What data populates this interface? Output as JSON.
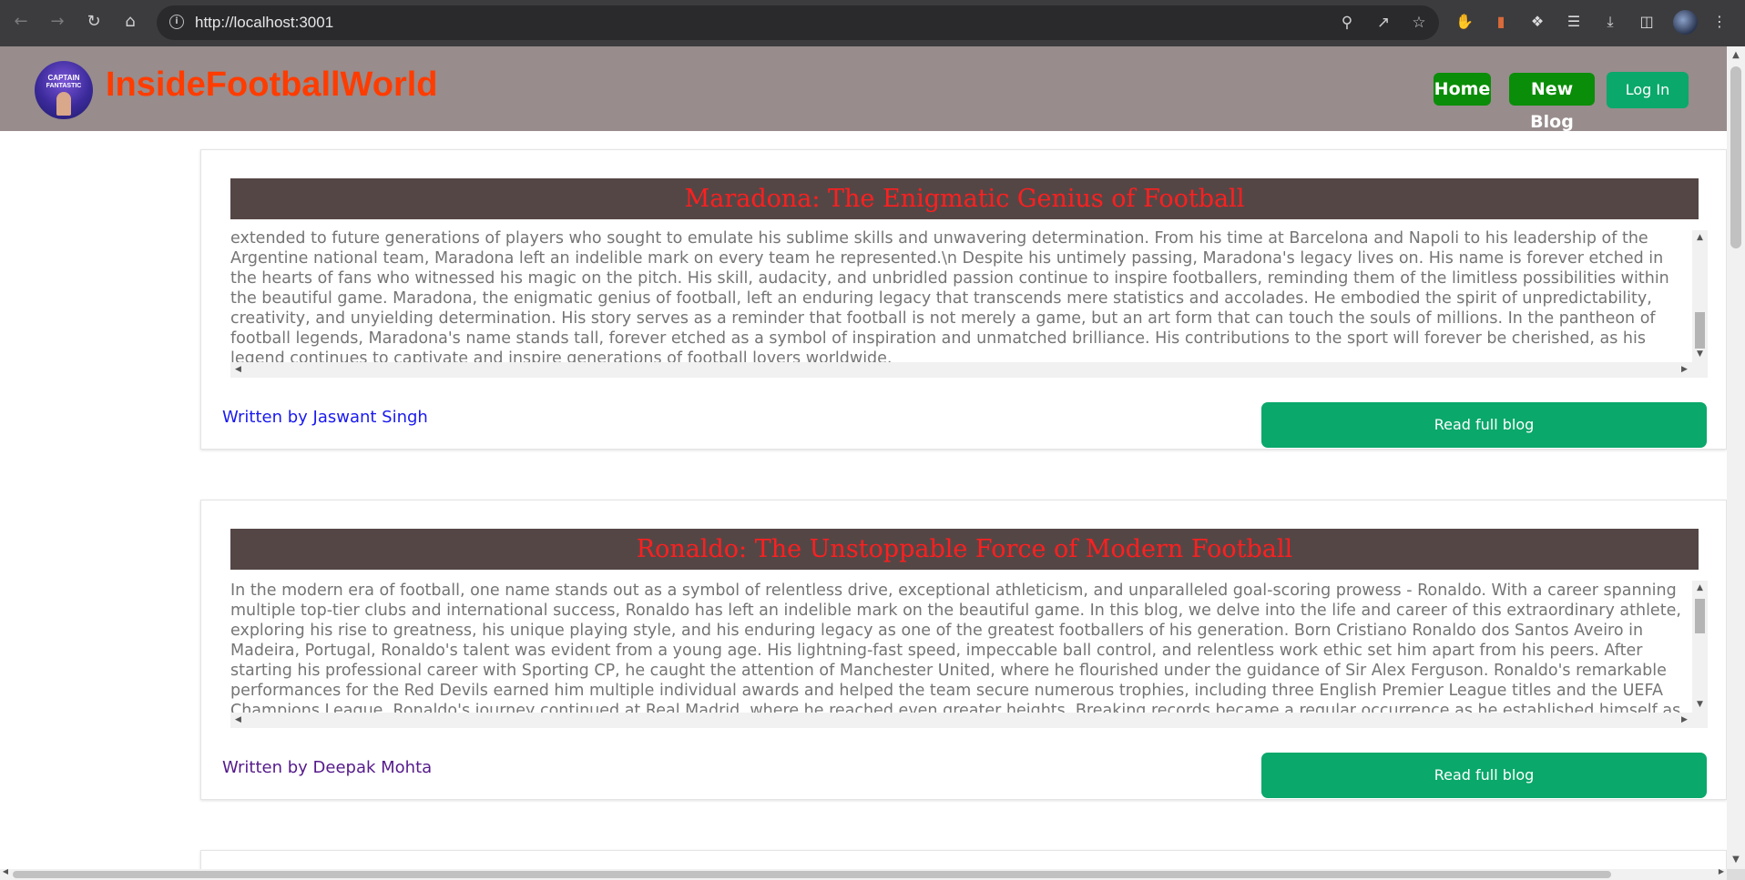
{
  "browser": {
    "url": "http://localhost:3001",
    "icons": [
      "back-icon",
      "forward-icon",
      "reload-icon",
      "home-icon",
      "site-info-icon",
      "zoom-icon",
      "share-icon",
      "bookmark-star-icon",
      "extension-stop-icon",
      "extension-book-icon",
      "extensions-puzzle-icon",
      "media-queue-icon",
      "download-icon",
      "side-panel-icon",
      "profile-avatar",
      "menu-kebab-icon"
    ]
  },
  "site": {
    "title": "InsideFootballWorld",
    "title_color": "#ff3c00",
    "header_bg": "#988c8c",
    "logo_text": [
      "CAPTAIN",
      "FANTASTIC"
    ],
    "nav": {
      "home": "Home",
      "new_blog": "New Blog",
      "login": "Log In"
    }
  },
  "posts": [
    {
      "title": "Maradona: The Enigmatic Genius of Football",
      "excerpt": "extended to future generations of players who sought to emulate his sublime skills and unwavering determination. From his time at Barcelona and Napoli to his leadership of the Argentine national team, Maradona left an indelible mark on every team he represented.\\n Despite his untimely passing, Maradona's legacy lives on. His name is forever etched in the hearts of fans who witnessed his magic on the pitch. His skill, audacity, and unbridled passion continue to inspire footballers, reminding them of the limitless possibilities within the beautiful game. Maradona, the enigmatic genius of football, left an enduring legacy that transcends mere statistics and accolades. He embodied the spirit of unpredictability, creativity, and unyielding determination. His story serves as a reminder that football is not merely a game, but an art form that can touch the souls of millions. In the pantheon of football legends, Maradona's name stands tall, forever etched as a symbol of inspiration and unmatched brilliance. His contributions to the sport will forever be cherished, as his legend continues to captivate and inspire generations of football lovers worldwide.",
      "author": "Written by Jaswant Singh",
      "read_label": "Read full blog"
    },
    {
      "title": "Ronaldo: The Unstoppable Force of Modern Football",
      "excerpt": "In the modern era of football, one name stands out as a symbol of relentless drive, exceptional athleticism, and unparalleled goal-scoring prowess - Ronaldo. With a career spanning multiple top-tier clubs and international success, Ronaldo has left an indelible mark on the beautiful game. In this blog, we delve into the life and career of this extraordinary athlete, exploring his rise to greatness, his unique playing style, and his enduring legacy as one of the greatest footballers of his generation. Born Cristiano Ronaldo dos Santos Aveiro in Madeira, Portugal, Ronaldo's talent was evident from a young age. His lightning-fast speed, impeccable ball control, and relentless work ethic set him apart from his peers. After starting his professional career with Sporting CP, he caught the attention of Manchester United, where he flourished under the guidance of Sir Alex Ferguson. Ronaldo's remarkable performances for the Red Devils earned him multiple individual awards and helped the team secure numerous trophies, including three English Premier League titles and the UEFA Champions League. Ronaldo's journey continued at Real Madrid, where he reached even greater heights. Breaking records became a regular occurrence as he established himself as",
      "author": "Written by Deepak Mohta",
      "read_label": "Read full blog"
    }
  ],
  "colors": {
    "nav_green": "#0a8d08",
    "button_green": "#0aa86a",
    "card_title_bg": "#554646",
    "card_title_text": "#ff1f1f"
  }
}
